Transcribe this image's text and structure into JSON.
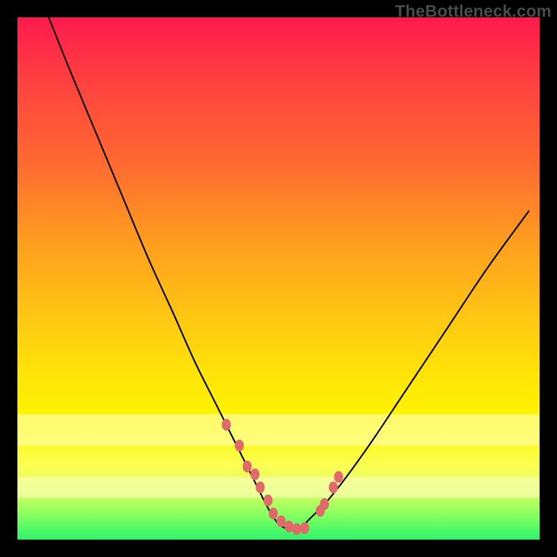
{
  "watermark": "TheBottleneck.com",
  "colors": {
    "dot": "#e06a6a",
    "curve": "#000000"
  },
  "chart_data": {
    "type": "line",
    "title": "",
    "xlabel": "",
    "ylabel": "",
    "xlim": [
      0,
      100
    ],
    "ylim": [
      0,
      100
    ],
    "grid": false,
    "series": [
      {
        "name": "bottleneck-curve",
        "x": [
          6,
          10,
          15,
          20,
          25,
          30,
          34,
          38,
          41,
          44,
          46,
          48,
          50,
          52,
          54,
          56,
          59,
          63,
          68,
          74,
          82,
          90,
          98
        ],
        "y": [
          100,
          90,
          78,
          66,
          54,
          43,
          34,
          26,
          20,
          14,
          10,
          6,
          3,
          2,
          2,
          4,
          7,
          12,
          19,
          28,
          40,
          52,
          63
        ]
      }
    ],
    "highlight_points": {
      "name": "marked-points",
      "x": [
        40,
        42.5,
        44,
        45.5,
        46.5,
        48,
        49,
        50.5,
        52,
        53.5,
        55,
        58,
        58.8,
        60.5,
        61.5
      ],
      "y": [
        22,
        18,
        14,
        12.5,
        10,
        7.5,
        5,
        3.5,
        2.5,
        2,
        2.2,
        5.5,
        6.8,
        10,
        12
      ]
    },
    "pale_bands_y": [
      [
        18,
        24
      ],
      [
        8,
        12
      ]
    ]
  }
}
